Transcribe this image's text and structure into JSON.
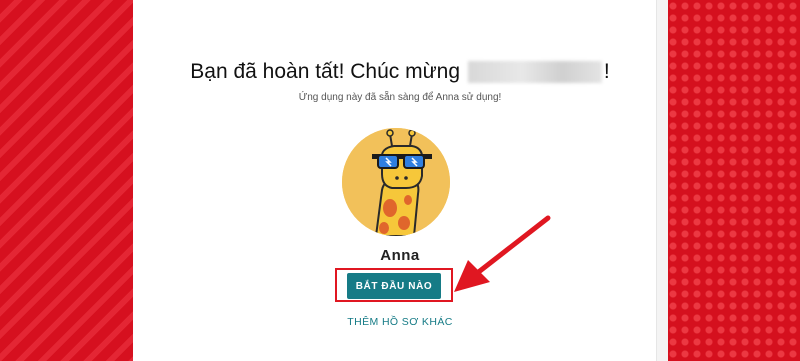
{
  "page": {
    "title_text": "Bạn đã hoàn tất! Chúc mừng",
    "title_exclaim": "!",
    "subtitle": "Ứng dụng này đã sẵn sàng để Anna sử dụng!",
    "username": "Anna",
    "start_button": "BẮT ĐẦU NÀO",
    "add_profile_link": "THÊM HỒ SƠ KHÁC"
  },
  "colors": {
    "background": "#d90f1e",
    "card": "#ffffff",
    "button": "#167b86",
    "highlight": "#e01721"
  },
  "icons": {
    "avatar": "giraffe-with-sunglasses-avatar",
    "annotation": "red-arrow-icon"
  }
}
